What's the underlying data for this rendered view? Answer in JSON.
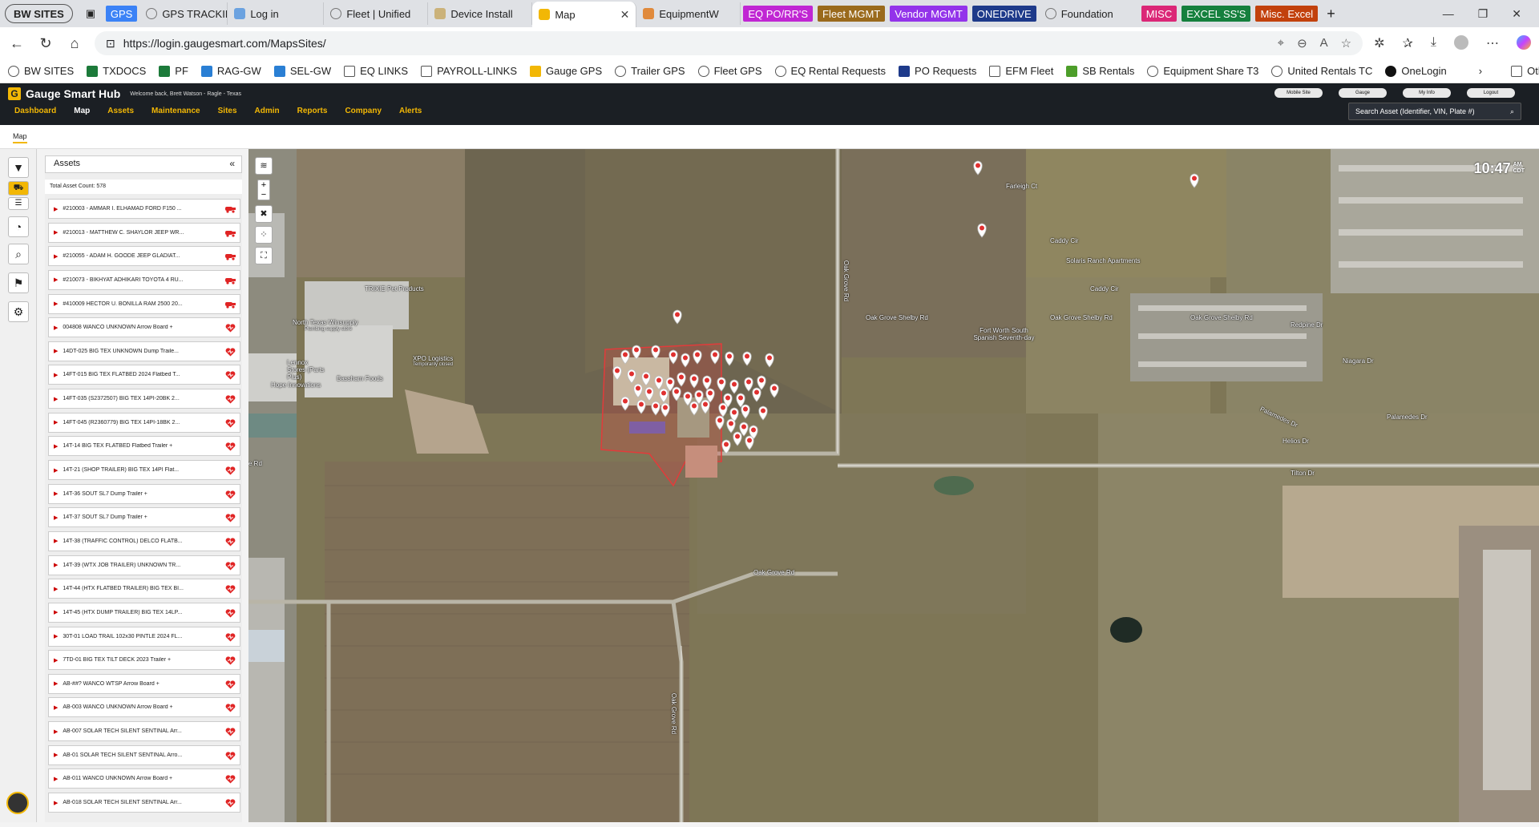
{
  "browser": {
    "tabs": [
      {
        "label": "BW SITES",
        "kind": "group"
      },
      {
        "label": "GPS",
        "kind": "pill",
        "color": "#3b82f6"
      },
      {
        "label": "GPS TRACKIN"
      },
      {
        "label": "Log in"
      },
      {
        "label": "Fleet | Unified"
      },
      {
        "label": "Device Install"
      },
      {
        "label": "Map",
        "active": true
      },
      {
        "label": "EquipmentW"
      },
      {
        "label": "EQ PO/RR'S",
        "kind": "pill",
        "color": "#c026d3"
      },
      {
        "label": "Fleet MGMT",
        "kind": "pill",
        "color": "#9a6a1c"
      },
      {
        "label": "Vendor MGMT",
        "kind": "pill",
        "color": "#9333ea"
      },
      {
        "label": "ONEDRIVE",
        "kind": "pill",
        "color": "#1e3a8a"
      },
      {
        "label": "Foundation"
      },
      {
        "label": "MISC",
        "kind": "pill",
        "color": "#db2777"
      },
      {
        "label": "EXCEL SS'S",
        "kind": "pill",
        "color": "#15803d"
      },
      {
        "label": "Misc. Excel",
        "kind": "pill",
        "color": "#c2410c"
      }
    ],
    "url": "https://login.gaugesmart.com/MapsSites/",
    "favorites": [
      "BW SITES",
      "TXDOCS",
      "PF",
      "RAG-GW",
      "SEL-GW",
      "EQ LINKS",
      "PAYROLL-LINKS",
      "Gauge GPS",
      "Trailer GPS",
      "Fleet GPS",
      "EQ Rental Requests",
      "PO Requests",
      "EFM Fleet",
      "SB Rentals",
      "Equipment Share T3",
      "United Rentals TC",
      "OneLogin"
    ],
    "other_favorites": "Other favorites"
  },
  "app": {
    "brand": "Gauge Smart Hub",
    "welcome": "Welcome back, Brett Watson - Ragle - Texas",
    "nav": [
      "Dashboard",
      "Map",
      "Assets",
      "Maintenance",
      "Sites",
      "Admin",
      "Reports",
      "Company",
      "Alerts"
    ],
    "active_nav": "Map",
    "top_buttons": [
      "Mobile Site",
      "Gauge",
      "My Info",
      "Logout"
    ],
    "search_placeholder": "Search Asset (Identifier, VIN, Plate #)",
    "breadcrumb": "Map"
  },
  "assets_panel": {
    "title": "Assets",
    "total_count": "Total Asset Count: 578",
    "items": [
      {
        "label": "#210003 - AMMAR I. ELHAMAD FORD F150 ...",
        "icon": "truck"
      },
      {
        "label": "#210013 - MATTHEW C. SHAYLOR JEEP WR...",
        "icon": "truck"
      },
      {
        "label": "#210055 - ADAM H. GOODE JEEP GLADIAT...",
        "icon": "truck"
      },
      {
        "label": "#210073 - BIKHYAT ADHIKARI TOYOTA 4 RU...",
        "icon": "truck"
      },
      {
        "label": "#410009 HECTOR U. BONILLA RAM 2500 20...",
        "icon": "truck"
      },
      {
        "label": "004808 WANCO UNKNOWN Arrow Board +",
        "icon": "heart"
      },
      {
        "label": "14DT-025 BIG TEX UNKNOWN Dump Traile...",
        "icon": "heart"
      },
      {
        "label": "14FT-015 BIG TEX FLATBED 2024 Flatbed T...",
        "icon": "heart"
      },
      {
        "label": "14FT-035 (S2372507) BIG TEX 14PI-20BK 2...",
        "icon": "heart"
      },
      {
        "label": "14FT-045 (R2360779) BIG TEX 14PI-18BK 2...",
        "icon": "heart"
      },
      {
        "label": "14T-14 BIG TEX FLATBED Flatbed Trailer +",
        "icon": "heart"
      },
      {
        "label": "14T-21 (SHOP TRAILER) BIG TEX 14PI Flat...",
        "icon": "heart"
      },
      {
        "label": "14T-36 SOUT SL7 Dump Trailer +",
        "icon": "heart"
      },
      {
        "label": "14T-37 SOUT SL7 Dump Trailer +",
        "icon": "heart"
      },
      {
        "label": "14T-38 (TRAFFIC CONTROL) DELCO FLATB...",
        "icon": "heart"
      },
      {
        "label": "14T-39 (WTX JOB TRAILER) UNKNOWN TR...",
        "icon": "heart"
      },
      {
        "label": "14T-44 (HTX FLATBED TRAILER) BIG TEX BI...",
        "icon": "heart"
      },
      {
        "label": "14T-45 (HTX DUMP TRAILER) BIG TEX 14LP...",
        "icon": "heart"
      },
      {
        "label": "30T-01 LOAD TRAIL 102x30 PINTLE 2024 FL...",
        "icon": "heart"
      },
      {
        "label": "7TD-01 BIG TEX TILT DECK 2023 Trailer +",
        "icon": "heart"
      },
      {
        "label": "AB-##? WANCO WTSP Arrow Board +",
        "icon": "heart"
      },
      {
        "label": "AB-003 WANCO UNKNOWN Arrow Board +",
        "icon": "heart"
      },
      {
        "label": "AB-007 SOLAR TECH SILENT SENTINAL Arr...",
        "icon": "heart"
      },
      {
        "label": "AB-01 SOLAR TECH SILENT SENTINAL Arro...",
        "icon": "heart"
      },
      {
        "label": "AB-011 WANCO UNKNOWN Arrow Board +",
        "icon": "heart"
      },
      {
        "label": "AB-018 SOLAR TECH SILENT SENTINAL Arr...",
        "icon": "heart"
      }
    ]
  },
  "map": {
    "clock": "10:47",
    "ampm": "AM",
    "tz": "CDT",
    "labels": {
      "tractor_supply": "TRIXIE Pet Products",
      "north_texas": "North Texas Winsupply",
      "north_texas_sub": "Plumbing supply store",
      "lennox": "Lennox Stores (Parts Plus)",
      "bassham": "Bassham Foods",
      "xpo": "XPO Logistics",
      "xpo_sub": "Temporarily closed",
      "hope": "Hope Innovations",
      "oak_grove_shelby_1": "Oak Grove Shelby Rd",
      "oak_grove_shelby_2": "Oak Grove Shelby Rd",
      "oak_grove_shelby_3": "Oak Grove Shelby Rd",
      "oak_grove_rd_v": "Oak Grove Rd",
      "oak_grove_rd_h": "Oak Grove Rd",
      "oak_grove_rd_v2": "Oak Grove Rd",
      "fort_worth_sda": "Fort Worth South Spanish Seventh-day",
      "solaris": "Solaris Ranch Apartments",
      "farleigh": "Farleigh Ct",
      "caddy": "Caddy Cir",
      "caddy2": "Caddy Cir",
      "redpine": "Redpine Dr",
      "niagara": "Niagara Dr",
      "palamedes": "Palamedes Dr",
      "palamedes2": "Palamedes Dr",
      "helios": "Helios Dr",
      "tilton": "Tilton Dr",
      "rd": "e Rd"
    },
    "colors": {
      "geofence": "#e23b3b",
      "pin": "#e03030"
    }
  }
}
